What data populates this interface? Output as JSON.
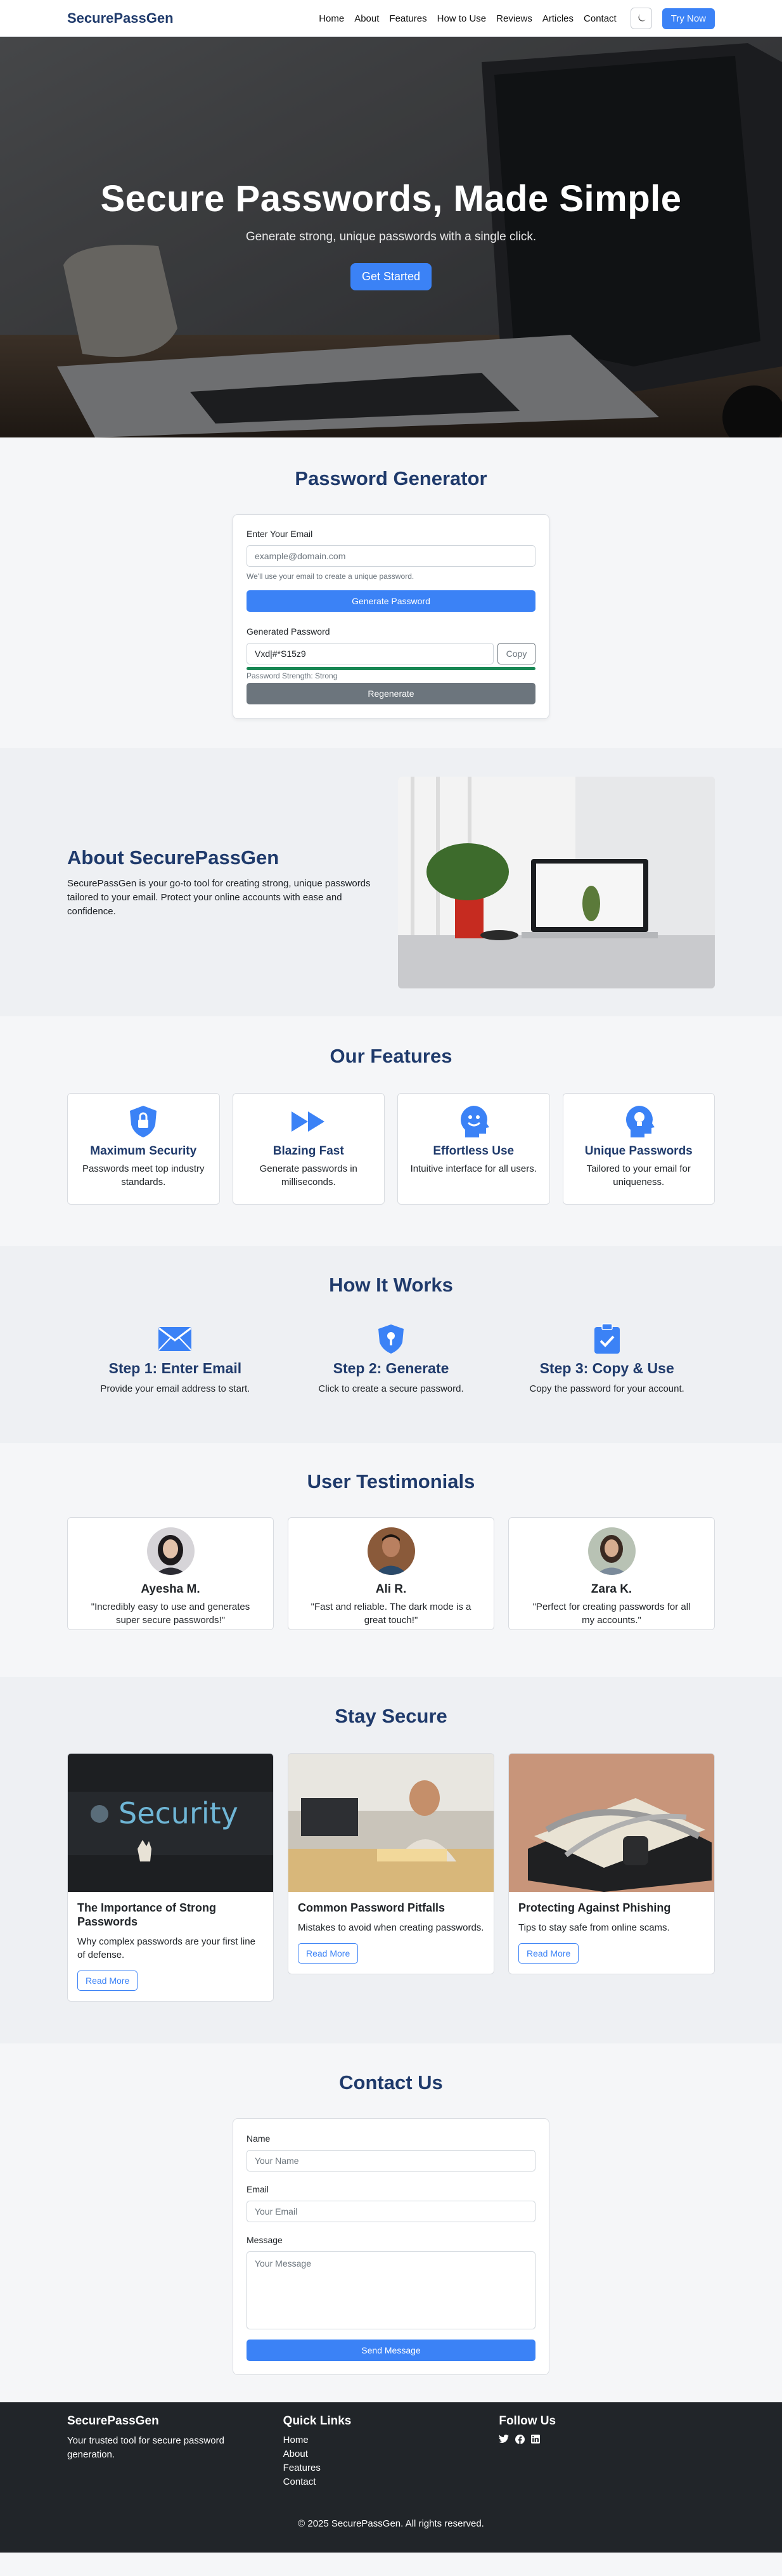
{
  "nav": {
    "brand": "SecurePassGen",
    "links": [
      "Home",
      "About",
      "Features",
      "How to Use",
      "Reviews",
      "Articles",
      "Contact"
    ],
    "theme_icon": "moon-icon",
    "cta": "Try Now"
  },
  "hero": {
    "title": "Secure Passwords, Made Simple",
    "subtitle": "Generate strong, unique passwords with a single click.",
    "button": "Get Started"
  },
  "generator": {
    "title": "Password Generator",
    "email_label": "Enter Your Email",
    "email_placeholder": "example@domain.com",
    "email_help": "We'll use your email to create a unique password.",
    "generate_button": "Generate Password",
    "generated_label": "Generated Password",
    "generated_value": "Vxd|#*S15z9",
    "copy_button": "Copy",
    "strength": 1.0,
    "strength_color": "#198754",
    "strength_text": "Password Strength: Strong",
    "regenerate_button": "Regenerate"
  },
  "about": {
    "title": "About SecurePassGen",
    "text": "SecurePassGen is your go-to tool for creating strong, unique passwords tailored to your email. Protect your online accounts with ease and confidence."
  },
  "features": {
    "title": "Our Features",
    "items": [
      {
        "icon": "shield-lock-icon",
        "title": "Maximum Security",
        "desc": "Passwords meet top industry standards."
      },
      {
        "icon": "fast-forward-icon",
        "title": "Blazing Fast",
        "desc": "Generate passwords in milliseconds."
      },
      {
        "icon": "smile-head-icon",
        "title": "Effortless Use",
        "desc": "Intuitive interface for all users."
      },
      {
        "icon": "lightbulb-head-icon",
        "title": "Unique Passwords",
        "desc": "Tailored to your email for uniqueness."
      }
    ]
  },
  "how": {
    "title": "How It Works",
    "steps": [
      {
        "icon": "envelope-icon",
        "title": "Step 1: Enter Email",
        "desc": "Provide your email address to start."
      },
      {
        "icon": "shield-key-icon",
        "title": "Step 2: Generate",
        "desc": "Click to create a secure password."
      },
      {
        "icon": "clipboard-check-icon",
        "title": "Step 3: Copy & Use",
        "desc": "Copy the password for your account."
      }
    ]
  },
  "testimonials": {
    "title": "User Testimonials",
    "items": [
      {
        "name": "Ayesha M.",
        "quote": "\"Incredibly easy to use and generates super secure passwords!\""
      },
      {
        "name": "Ali R.",
        "quote": "\"Fast and reliable. The dark mode is a great touch!\""
      },
      {
        "name": "Zara K.",
        "quote": "\"Perfect for creating passwords for all my accounts.\""
      }
    ]
  },
  "blog": {
    "title": "Stay Secure",
    "items": [
      {
        "image_text": "Security",
        "title": "The Importance of Strong Passwords",
        "desc": "Why complex passwords are your first line of defense.",
        "button": "Read More"
      },
      {
        "title": "Common Password Pitfalls",
        "desc": "Mistakes to avoid when creating passwords.",
        "button": "Read More"
      },
      {
        "title": "Protecting Against Phishing",
        "desc": "Tips to stay safe from online scams.",
        "button": "Read More"
      }
    ]
  },
  "contact": {
    "title": "Contact Us",
    "name_label": "Name",
    "name_placeholder": "Your Name",
    "email_label": "Email",
    "email_placeholder": "Your Email",
    "message_label": "Message",
    "message_placeholder": "Your Message",
    "button": "Send Message"
  },
  "footer": {
    "brand": "SecurePassGen",
    "tagline": "Your trusted tool for secure password generation.",
    "quick_title": "Quick Links",
    "quick_links": [
      "Home",
      "About",
      "Features",
      "Contact"
    ],
    "follow_title": "Follow Us",
    "social_icons": [
      "twitter-icon",
      "facebook-icon",
      "linkedin-icon"
    ],
    "copyright": "© 2025 SecurePassGen. All rights reserved."
  },
  "colors": {
    "primary": "#3b82f6",
    "heading": "#1f3a6b",
    "footer_bg": "#212529"
  }
}
